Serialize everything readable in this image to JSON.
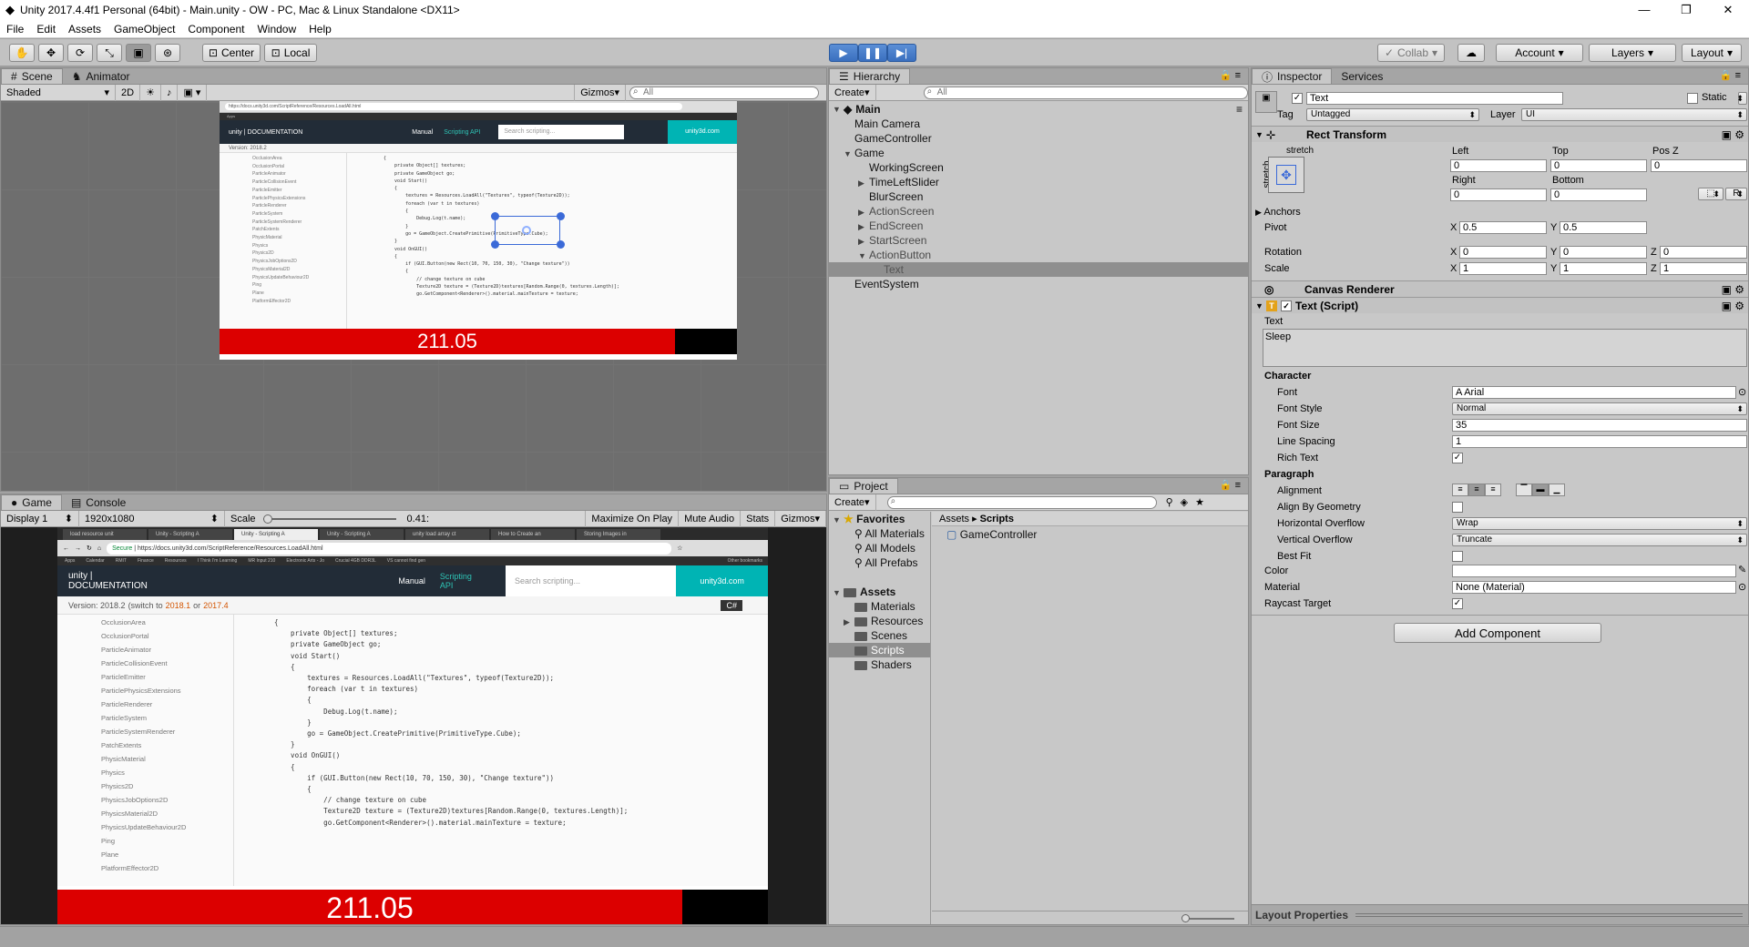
{
  "window": {
    "title": "Unity 2017.4.4f1 Personal (64bit) - Main.unity - OW - PC, Mac & Linux Standalone <DX11>",
    "minimize": "—",
    "maximize": "❐",
    "close": "✕"
  },
  "menu": [
    "File",
    "Edit",
    "Assets",
    "GameObject",
    "Component",
    "Window",
    "Help"
  ],
  "toolbar": {
    "center": "Center",
    "local": "Local",
    "collab": "Collab",
    "account": "Account",
    "layers": "Layers",
    "layout": "Layout"
  },
  "scene": {
    "tabs": [
      "Scene",
      "Animator"
    ],
    "shading": "Shaded",
    "mode2d": "2D",
    "gizmos": "Gizmos",
    "search_placeholder": "All"
  },
  "game": {
    "tabs": [
      "Game",
      "Console"
    ],
    "display": "Display 1",
    "resolution": "1920x1080",
    "scale_label": "Scale",
    "scale_value": "0.41:",
    "scale_fraction": 0.41,
    "maximize": "Maximize On Play",
    "mute": "Mute Audio",
    "stats": "Stats",
    "gizmos": "Gizmos",
    "timer": "211.05",
    "timer_fill": 0.88
  },
  "browser": {
    "url": "https://docs.unity3d.com/ScriptReference/Resources.LoadAll.html",
    "secure": "Secure",
    "tabs": [
      "load resource unit",
      "Unity - Scripting A",
      "Unity - Scripting A",
      "Unity - Scripting A",
      "unity load array ct",
      "How to Create an",
      "Storing Images in"
    ],
    "bookmarks": [
      "Apps",
      "Calendar",
      "RMIT",
      "Finance",
      "Resources",
      "I Think I'm Learning",
      "MR Input 210",
      "Electronic Arts - Jo",
      "Crucial 4GB DDR3L",
      "VS cannot find gen"
    ],
    "other_bookmarks": "Other bookmarks",
    "logo": "unity | DOCUMENTATION",
    "manual": "Manual",
    "scripting": "Scripting API",
    "search": "Search scripting...",
    "site": "unity3d.com",
    "version": "Version: 2018.2",
    "version_switch": "(switch to",
    "v1": "2018.1",
    "or": "or",
    "v2": "2017.4",
    "lang": "C#",
    "sidebar": [
      "OcclusionArea",
      "OcclusionPortal",
      "ParticleAnimator",
      "ParticleCollisionEvent",
      "ParticleEmitter",
      "ParticlePhysicsExtensions",
      "ParticleRenderer",
      "ParticleSystem",
      "ParticleSystemRenderer",
      "PatchExtents",
      "PhysicMaterial",
      "Physics",
      "Physics2D",
      "PhysicsJobOptions2D",
      "PhysicsMaterial2D",
      "PhysicsUpdateBehaviour2D",
      "Ping",
      "Plane",
      "PlatformEffector2D"
    ],
    "code": [
      "{",
      "    private Object[] textures;",
      "    private GameObject go;",
      "",
      "    void Start()",
      "    {",
      "        textures = Resources.LoadAll(\"Textures\", typeof(Texture2D));",
      "",
      "        foreach (var t in textures)",
      "        {",
      "            Debug.Log(t.name);",
      "        }",
      "",
      "        go = GameObject.CreatePrimitive(PrimitiveType.Cube);",
      "    }",
      "",
      "    void OnGUI()",
      "    {",
      "        if (GUI.Button(new Rect(10, 70, 150, 30), \"Change texture\"))",
      "        {",
      "            // change texture on cube",
      "            Texture2D texture = (Texture2D)textures[Random.Range(0, textures.Length)];",
      "            go.GetComponent<Renderer>().material.mainTexture = texture;"
    ]
  },
  "hierarchy": {
    "tab": "Hierarchy",
    "create": "Create",
    "search_placeholder": "All",
    "rows": [
      {
        "label": "Main",
        "depth": 0,
        "arrow": "▼",
        "bold": true
      },
      {
        "label": "Main Camera",
        "depth": 1,
        "arrow": ""
      },
      {
        "label": "GameController",
        "depth": 1,
        "arrow": ""
      },
      {
        "label": "Game",
        "depth": 1,
        "arrow": "▼"
      },
      {
        "label": "WorkingScreen",
        "depth": 2,
        "arrow": ""
      },
      {
        "label": "TimeLeftSlider",
        "depth": 2,
        "arrow": "▶"
      },
      {
        "label": "BlurScreen",
        "depth": 2,
        "arrow": ""
      },
      {
        "label": "ActionScreen",
        "depth": 2,
        "arrow": "▶",
        "dim": true
      },
      {
        "label": "EndScreen",
        "depth": 2,
        "arrow": "▶",
        "dim": true
      },
      {
        "label": "StartScreen",
        "depth": 2,
        "arrow": "▶",
        "dim": true
      },
      {
        "label": "ActionButton",
        "depth": 2,
        "arrow": "▼",
        "dim": true
      },
      {
        "label": "Text",
        "depth": 3,
        "arrow": "",
        "selected": true
      },
      {
        "label": "EventSystem",
        "depth": 1,
        "arrow": ""
      }
    ]
  },
  "project": {
    "tab": "Project",
    "create": "Create",
    "favorites": "Favorites",
    "fav_items": [
      "All Materials",
      "All Models",
      "All Prefabs"
    ],
    "assets": "Assets",
    "asset_items": [
      "Materials",
      "Resources",
      "Scenes",
      "Scripts",
      "Shaders"
    ],
    "breadcrumb_root": "Assets",
    "breadcrumb_leaf": "Scripts",
    "files": [
      "GameController"
    ]
  },
  "inspector": {
    "tabs": [
      "Inspector",
      "Services"
    ],
    "object_name": "Text",
    "static": "Static",
    "tag_label": "Tag",
    "tag_value": "Untagged",
    "layer_label": "Layer",
    "layer_value": "UI",
    "rect_transform": "Rect Transform",
    "stretch": "stretch",
    "left_label": "Left",
    "left": "0",
    "top_label": "Top",
    "top": "0",
    "posz_label": "Pos Z",
    "posz": "0",
    "right_label": "Right",
    "right": "0",
    "bottom_label": "Bottom",
    "bottom": "0",
    "r_button": "R",
    "anchors": "Anchors",
    "pivot": "Pivot",
    "pivot_x": "0.5",
    "pivot_y": "0.5",
    "rotation": "Rotation",
    "rot_x": "0",
    "rot_y": "0",
    "rot_z": "0",
    "scale": "Scale",
    "scale_x": "1",
    "scale_y": "1",
    "scale_z": "1",
    "canvas_renderer": "Canvas Renderer",
    "text_script": "Text (Script)",
    "text_label": "Text",
    "text_value": "Sleep",
    "character": "Character",
    "font": "Font",
    "font_value": "Arial",
    "font_style": "Font Style",
    "font_style_value": "Normal",
    "font_size": "Font Size",
    "font_size_value": "35",
    "line_spacing": "Line Spacing",
    "line_spacing_value": "1",
    "rich_text": "Rich Text",
    "paragraph": "Paragraph",
    "alignment": "Alignment",
    "align_geometry": "Align By Geometry",
    "h_overflow": "Horizontal Overflow",
    "h_overflow_value": "Wrap",
    "v_overflow": "Vertical Overflow",
    "v_overflow_value": "Truncate",
    "best_fit": "Best Fit",
    "color": "Color",
    "material": "Material",
    "material_value": "None (Material)",
    "raycast": "Raycast Target",
    "add_component": "Add Component",
    "layout_properties": "Layout Properties",
    "check": "✓"
  }
}
